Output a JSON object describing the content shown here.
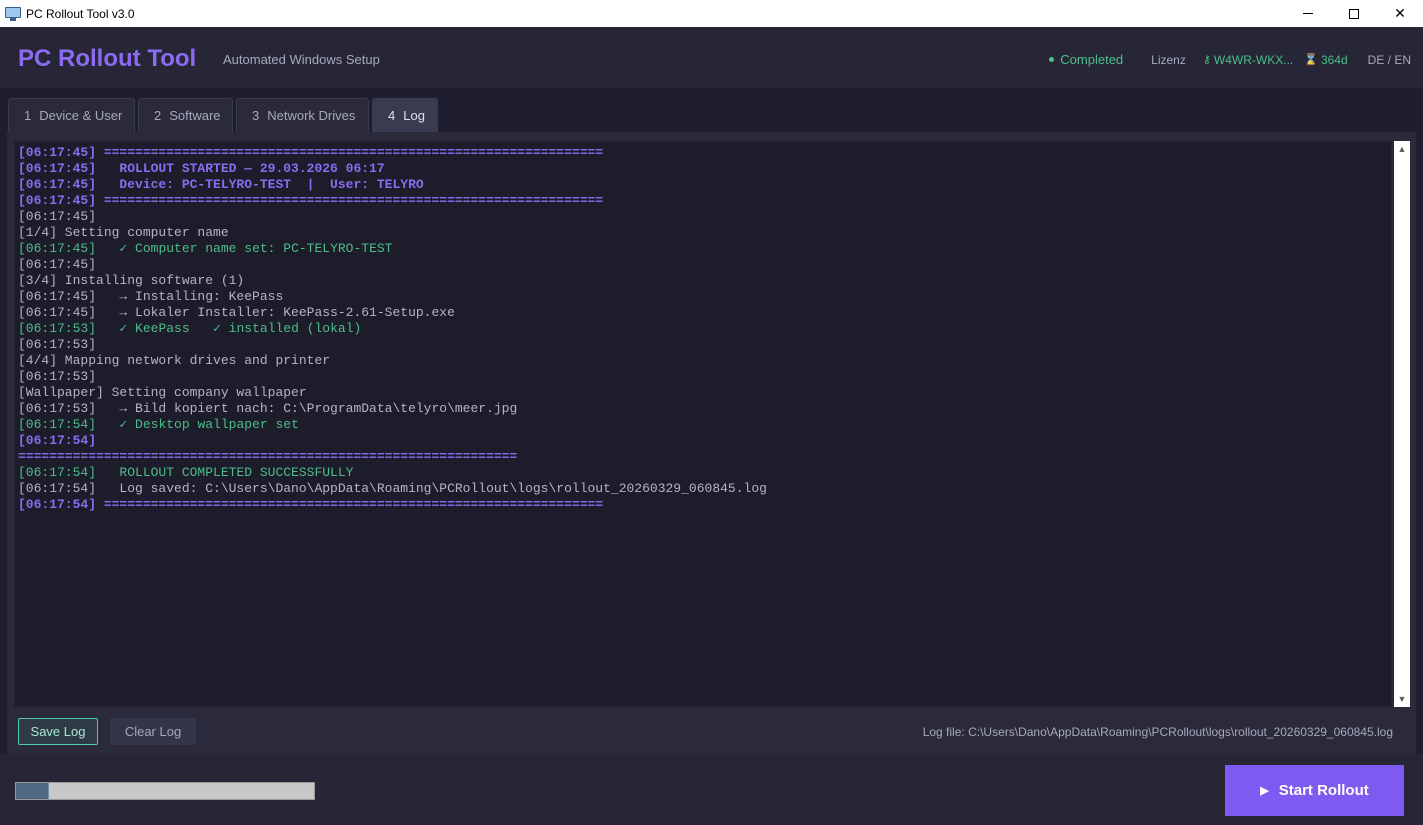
{
  "window": {
    "title": "PC Rollout Tool v3.0"
  },
  "header": {
    "brand": "PC Rollout Tool",
    "subtitle": "Automated Windows Setup",
    "status": "Completed",
    "license_label": "Lizenz",
    "license_key": "W4WR-WKX...",
    "days_left": "364d",
    "language": "DE / EN"
  },
  "tabs": [
    {
      "num": "1",
      "label": "Device & User"
    },
    {
      "num": "2",
      "label": "Software"
    },
    {
      "num": "3",
      "label": "Network Drives"
    },
    {
      "num": "4",
      "label": "Log"
    }
  ],
  "log": {
    "lines": [
      {
        "text": "[06:17:45] ================================================================",
        "color": "#8b6cf0",
        "bold": true
      },
      {
        "text": "[06:17:45]   ROLLOUT STARTED — 29.03.2026 06:17",
        "color": "#8b6cf0",
        "bold": true
      },
      {
        "text": "[06:17:45]   Device: PC-TELYRO-TEST  |  User: TELYRO",
        "color": "#8b6cf0",
        "bold": true
      },
      {
        "text": "[06:17:45] ================================================================",
        "color": "#8b6cf0",
        "bold": true
      },
      {
        "text": "[06:17:45]",
        "color": "#b4b4c4",
        "bold": false
      },
      {
        "text": "[1/4] Setting computer name",
        "color": "#b4b4c4",
        "bold": false
      },
      {
        "text": "[06:17:45]   ✓ Computer name set: PC-TELYRO-TEST",
        "color": "#4dbd8a",
        "bold": false
      },
      {
        "text": "[06:17:45]",
        "color": "#b4b4c4",
        "bold": false
      },
      {
        "text": "[3/4] Installing software (1)",
        "color": "#b4b4c4",
        "bold": false
      },
      {
        "text": "[06:17:45]   → Installing: KeePass",
        "color": "#b4b4c4",
        "bold": false
      },
      {
        "text": "[06:17:45]   → Lokaler Installer: KeePass-2.61-Setup.exe",
        "color": "#b4b4c4",
        "bold": false
      },
      {
        "text": "[06:17:53]   ✓ KeePass   ✓ installed (lokal)",
        "color": "#4dbd8a",
        "bold": false
      },
      {
        "text": "[06:17:53]",
        "color": "#b4b4c4",
        "bold": false
      },
      {
        "text": "[4/4] Mapping network drives and printer",
        "color": "#b4b4c4",
        "bold": false
      },
      {
        "text": "[06:17:53]",
        "color": "#b4b4c4",
        "bold": false
      },
      {
        "text": "[Wallpaper] Setting company wallpaper",
        "color": "#b4b4c4",
        "bold": false
      },
      {
        "text": "[06:17:53]   → Bild kopiert nach: C:\\ProgramData\\telyro\\meer.jpg",
        "color": "#b4b4c4",
        "bold": false
      },
      {
        "text": "[06:17:54]   ✓ Desktop wallpaper set",
        "color": "#4dbd8a",
        "bold": false
      },
      {
        "text": "[06:17:54]",
        "color": "#8b6cf0",
        "bold": true
      },
      {
        "text": "================================================================",
        "color": "#8b6cf0",
        "bold": true
      },
      {
        "text": "[06:17:54]   ROLLOUT COMPLETED SUCCESSFULLY",
        "color": "#4dbd8a",
        "bold": false
      },
      {
        "text": "[06:17:54]   Log saved: C:\\Users\\Dano\\AppData\\Roaming\\PCRollout\\logs\\rollout_20260329_060845.log",
        "color": "#b4b4c4",
        "bold": false
      },
      {
        "text": "[06:17:54] ================================================================",
        "color": "#8b6cf0",
        "bold": true
      }
    ],
    "save_label": "Save Log",
    "clear_label": "Clear Log",
    "file_info": "Log file: C:\\Users\\Dano\\AppData\\Roaming\\PCRollout\\logs\\rollout_20260329_060845.log"
  },
  "progress": {
    "fraction": 0.11
  },
  "actions": {
    "start_label": "Start Rollout"
  },
  "colors": {
    "accent": "#7f5af0",
    "success": "#4dbd8a",
    "log_bg": "#1c1c2a"
  }
}
